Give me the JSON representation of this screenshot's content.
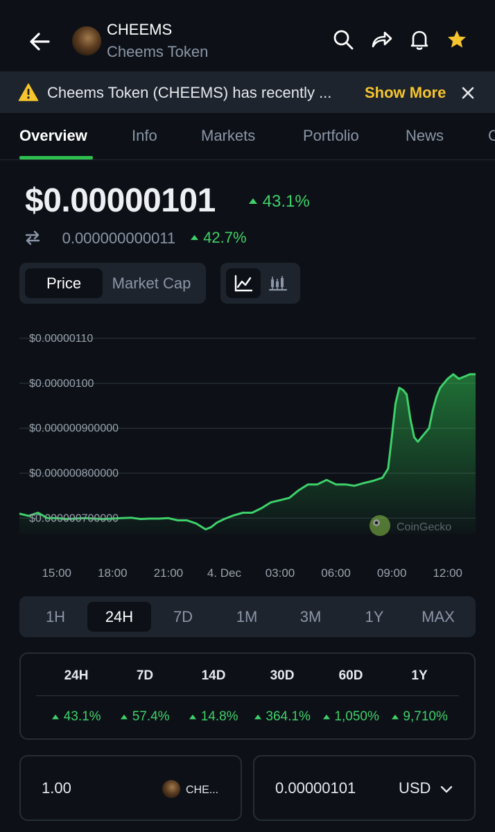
{
  "header": {
    "token_symbol": "CHEEMS",
    "token_name": "Cheems Token",
    "icons": [
      "back-arrow-icon",
      "search-icon",
      "share-icon",
      "bell-icon",
      "star-icon"
    ],
    "star_color": "#f6c42d"
  },
  "banner": {
    "text": "Cheems Token (CHEEMS) has recently ...",
    "action_label": "Show More",
    "accent_color": "#f6c42d"
  },
  "tabs": [
    {
      "label": "Overview",
      "active": true
    },
    {
      "label": "Info"
    },
    {
      "label": "Markets"
    },
    {
      "label": "Portfolio"
    },
    {
      "label": "News"
    },
    {
      "label": "C"
    }
  ],
  "price": {
    "usd": "$0.00000101",
    "usd_change": "43.1%",
    "btc": "0.000000000011",
    "btc_change": "42.7%",
    "up_color": "#3ed16a"
  },
  "metric_toggle": {
    "options": [
      "Price",
      "Market Cap"
    ],
    "selected": "Price"
  },
  "chart_type_toggle": {
    "options": [
      "line-chart-icon",
      "candlestick-icon"
    ],
    "selected": "line-chart-icon"
  },
  "chart_data": {
    "type": "area",
    "y_tick_labels": [
      "$0.00000110",
      "$0.00000100",
      "$0.000000900000",
      "$0.000000800000",
      "$0.000000700000"
    ],
    "y_ticks": [
      1.1,
      1.0,
      0.9,
      0.8,
      0.7
    ],
    "y_unit_scale": "1e-6 USD",
    "ylim": [
      0.665,
      1.12
    ],
    "x_tick_labels": [
      "15:00",
      "18:00",
      "21:00",
      "4. Dec",
      "03:00",
      "06:00",
      "09:00",
      "12:00"
    ],
    "x_ticks_hours": [
      15,
      18,
      21,
      24,
      27,
      30,
      33,
      36
    ],
    "xlim_hours": [
      13.0,
      37.5
    ],
    "grid": true,
    "line_color": "#3ed16a",
    "watermark": "CoinGecko",
    "series": [
      {
        "x_hours": [
          13.0,
          13.5,
          14.0,
          14.5,
          15.0,
          15.5,
          16.0,
          16.5,
          17.0,
          17.5,
          18.0,
          18.5,
          19.0,
          19.5,
          20.0,
          20.5,
          21.0,
          21.5,
          22.0,
          22.5,
          23.0,
          23.3,
          23.6,
          24.0,
          24.5,
          25.0,
          25.5,
          26.0,
          26.5,
          27.0,
          27.5,
          28.0,
          28.5,
          29.0,
          29.5,
          30.0,
          30.5,
          31.0,
          31.5,
          32.0,
          32.5,
          32.8,
          33.0,
          33.2,
          33.4,
          33.6,
          33.8,
          34.0,
          34.2,
          34.4,
          34.6,
          34.8,
          35.0,
          35.2,
          35.4,
          35.6,
          35.8,
          36.0,
          36.3,
          36.6,
          36.9,
          37.2,
          37.5
        ],
        "values": [
          0.71,
          0.705,
          0.712,
          0.7,
          0.7,
          0.698,
          0.699,
          0.7,
          0.699,
          0.698,
          0.699,
          0.7,
          0.701,
          0.698,
          0.699,
          0.699,
          0.7,
          0.695,
          0.695,
          0.688,
          0.675,
          0.68,
          0.69,
          0.698,
          0.706,
          0.712,
          0.712,
          0.722,
          0.735,
          0.74,
          0.745,
          0.762,
          0.775,
          0.775,
          0.785,
          0.775,
          0.775,
          0.772,
          0.778,
          0.783,
          0.79,
          0.81,
          0.88,
          0.955,
          0.99,
          0.985,
          0.975,
          0.92,
          0.88,
          0.87,
          0.88,
          0.89,
          0.9,
          0.94,
          0.97,
          0.99,
          1.0,
          1.01,
          1.02,
          1.01,
          1.015,
          1.02,
          1.02
        ]
      }
    ]
  },
  "ranges": {
    "options": [
      "1H",
      "24H",
      "7D",
      "1M",
      "3M",
      "1Y",
      "MAX"
    ],
    "selected": "24H"
  },
  "performance": {
    "columns": [
      "24H",
      "7D",
      "14D",
      "30D",
      "60D",
      "1Y"
    ],
    "values": [
      "43.1%",
      "57.4%",
      "14.8%",
      "364.1%",
      "1,050%",
      "9,710%"
    ]
  },
  "converter": {
    "from_amount": "1.00",
    "from_symbol": "CHE...",
    "to_amount": "0.00000101",
    "to_currency": "USD"
  }
}
